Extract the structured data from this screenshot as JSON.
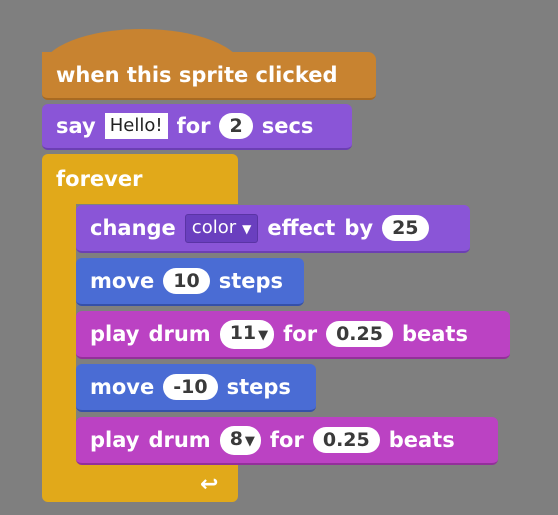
{
  "hat": {
    "label": "when this sprite clicked"
  },
  "say": {
    "word1": "say",
    "text": "Hello!",
    "word2": "for",
    "secs": "2",
    "word3": "secs"
  },
  "forever": {
    "label": "forever",
    "loop_arrow": "↩"
  },
  "change": {
    "word1": "change",
    "effect": "color",
    "word2": "effect",
    "word3": "by",
    "amount": "25"
  },
  "move1": {
    "word1": "move",
    "steps": "10",
    "word2": "steps"
  },
  "drum1": {
    "word1": "play",
    "word2": "drum",
    "drum": "11",
    "word3": "for",
    "beats": "0.25",
    "word4": "beats"
  },
  "move2": {
    "word1": "move",
    "steps": "-10",
    "word2": "steps"
  },
  "drum2": {
    "word1": "play",
    "word2": "drum",
    "drum": "8",
    "word3": "for",
    "beats": "0.25",
    "word4": "beats"
  },
  "colors": {
    "events": "#c88330",
    "looks": "#8a55d7",
    "motion": "#4a6cd4",
    "sound": "#bb42c3",
    "control": "#e1a91a"
  }
}
